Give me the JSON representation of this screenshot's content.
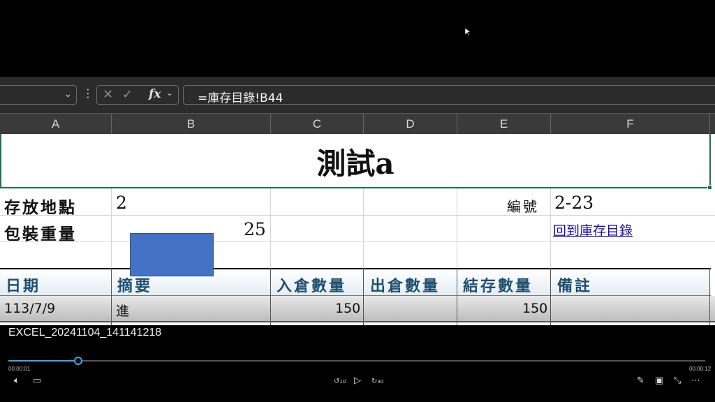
{
  "formula_bar": {
    "fx_label": "fx",
    "formula": "=庫存目錄!B44"
  },
  "columns": [
    "A",
    "B",
    "C",
    "D",
    "E",
    "F"
  ],
  "sheet": {
    "title": "測試a",
    "storage_label": "存放地點",
    "storage_value_partial": "2",
    "id_label": "編號",
    "id_value": "2-23",
    "package_label": "包裝重量",
    "package_value": "25",
    "back_link": "回到庫存目錄",
    "table_headers": [
      "日期",
      "摘要",
      "入倉數量",
      "出倉數量",
      "結存數量",
      "備註"
    ],
    "rows": [
      {
        "date": "113/7/9",
        "summary": "進",
        "in": "150",
        "out": "",
        "balance": "150",
        "note": ""
      }
    ]
  },
  "player": {
    "filename": "EXCEL_20241104_141141218",
    "elapsed": "00:00:01",
    "duration": "00:00:12",
    "progress": 0.1,
    "rewind_label": "10",
    "forward_label": "30"
  },
  "colors": {
    "selection_border": "#217346",
    "shape_fill": "#4472c4",
    "link": "#1a0dab",
    "progress": "#4aa3df"
  }
}
